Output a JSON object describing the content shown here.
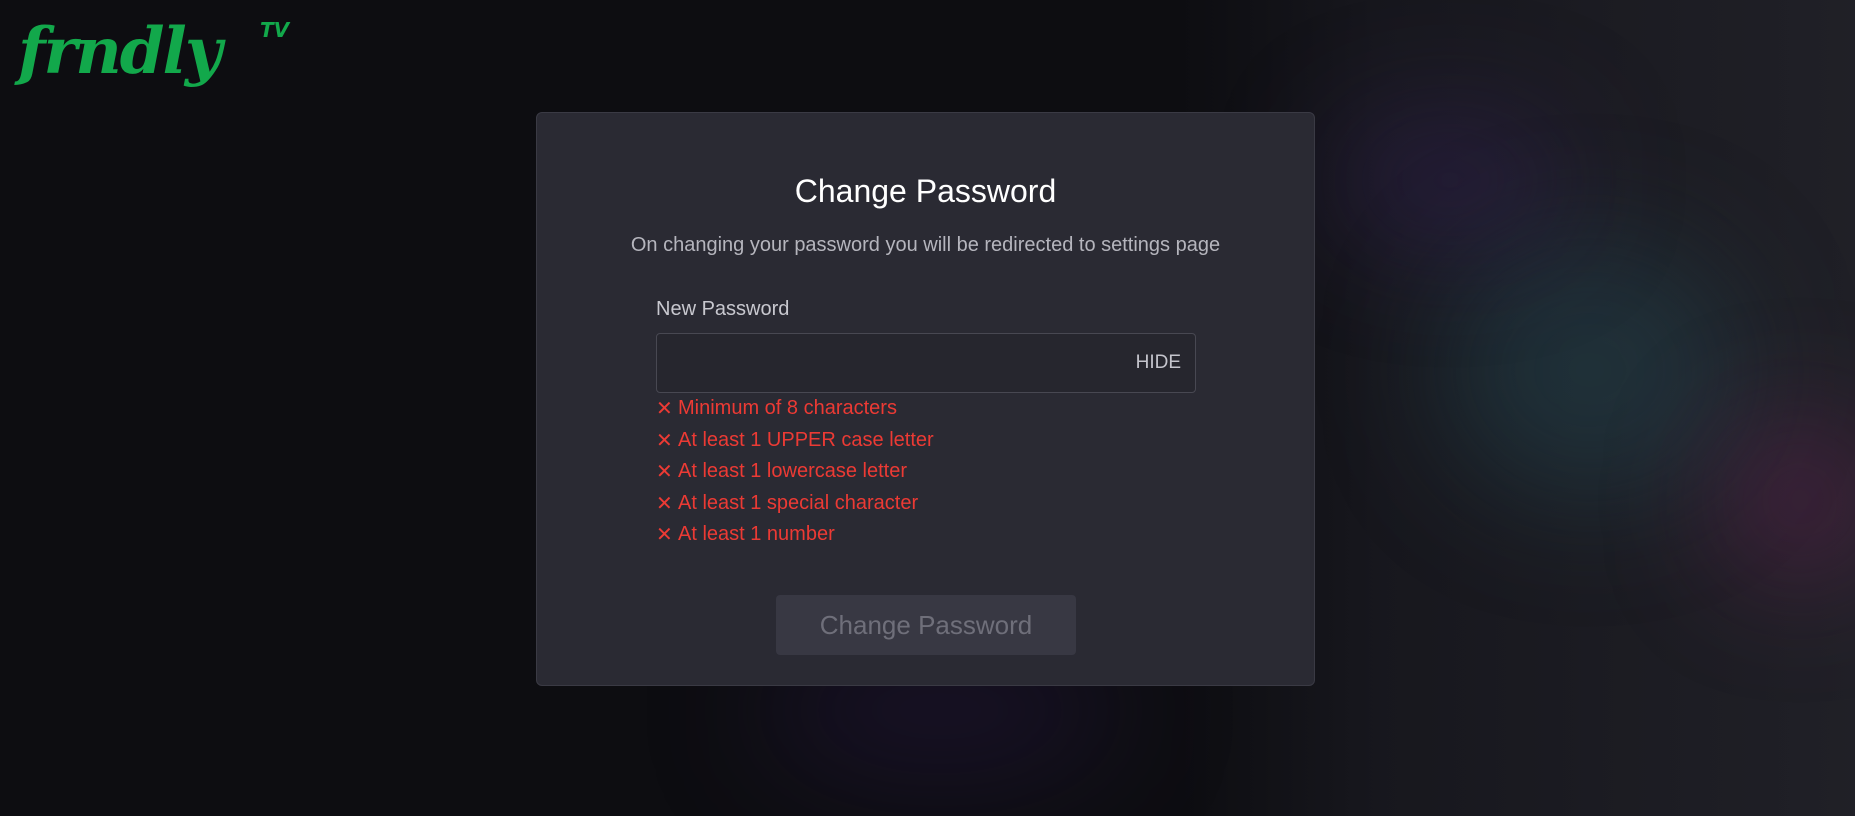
{
  "logo": {
    "word": "frndly",
    "tv": "TV",
    "color": "#12a84b"
  },
  "card": {
    "title": "Change Password",
    "subtitle": "On changing your password you will be redirected to settings page"
  },
  "form": {
    "new_password_label": "New Password",
    "new_password_value": "",
    "toggle_label": "HIDE",
    "submit_label": "Change Password",
    "submit_disabled": true
  },
  "requirements": [
    {
      "icon": "x-icon",
      "text": "Minimum of 8 characters",
      "met": false
    },
    {
      "icon": "x-icon",
      "text": "At least 1 UPPER case letter",
      "met": false
    },
    {
      "icon": "x-icon",
      "text": "At least 1 lowercase letter",
      "met": false
    },
    {
      "icon": "x-icon",
      "text": "At least 1 special character",
      "met": false
    },
    {
      "icon": "x-icon",
      "text": "At least 1 number",
      "met": false
    }
  ],
  "colors": {
    "error": "#ec3a34",
    "card_bg": "#2a2a33",
    "page_bg": "#0d0d11"
  }
}
